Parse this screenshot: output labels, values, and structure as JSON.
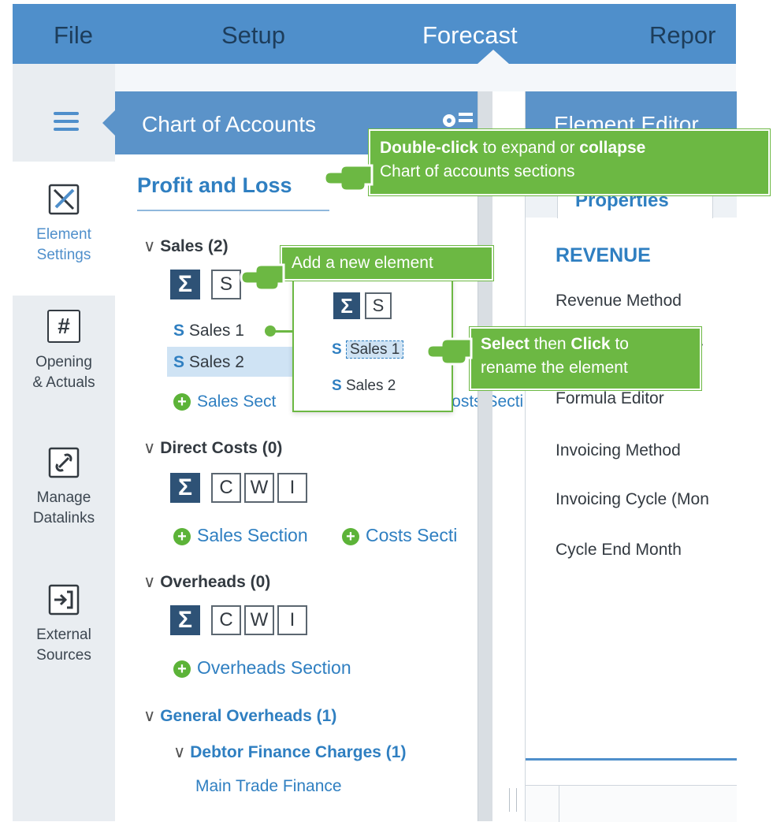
{
  "nav": {
    "file": "File",
    "setup": "Setup",
    "forecast": "Forecast",
    "reports": "Repor"
  },
  "sidebar": {
    "items": [
      {
        "label1": "Element",
        "label2": "Settings",
        "icon": "ruler-pencil-icon"
      },
      {
        "label1": "Opening",
        "label2": "& Actuals",
        "icon": "hash-icon"
      },
      {
        "label1": "Manage",
        "label2": "Datalinks",
        "icon": "link-icon"
      },
      {
        "label1": "External",
        "label2": "Sources",
        "icon": "import-icon"
      }
    ]
  },
  "coa": {
    "title": "Chart of Accounts",
    "section_title": "Profit and Loss",
    "sales": {
      "header": "Sales (2)",
      "items": [
        "Sales 1",
        "Sales 2"
      ],
      "add_sales": "Sales Sect",
      "add_costs": "Costs Secti"
    },
    "direct_costs": {
      "header": "Direct Costs (0)",
      "add_sales": "Sales Section",
      "add_costs": "Costs Secti"
    },
    "overheads": {
      "header": "Overheads (0)",
      "add_overheads": "Overheads Section"
    },
    "general_overheads": {
      "header": "General Overheads (1)",
      "sub_header": "Debtor Finance Charges (1)",
      "item": "Main Trade Finance"
    },
    "btn_s": "S",
    "btn_c": "C",
    "btn_w": "W",
    "btn_i": "I",
    "sigma": "Σ",
    "s_tag": "S"
  },
  "editor": {
    "title": "Element Editor",
    "tab": "Properties",
    "section": "REVENUE",
    "fields": [
      "Revenue Method",
      "Formula Editor",
      "Invoicing Method",
      "Invoicing Cycle (Mon",
      "Cycle End Month"
    ],
    "partial_r": "r"
  },
  "callouts": {
    "dbl_bold1": "Double-click",
    "dbl_text1": " to expand or ",
    "dbl_bold2": "collapse",
    "dbl_line2": "Chart of accounts sections",
    "add": "Add a new element",
    "sel_bold1": "Select",
    "sel_text1": " then ",
    "sel_bold2": "Click",
    "sel_text2": " to",
    "sel_line2": "rename the element"
  },
  "popup": {
    "item1": "Sales 1",
    "item2": "Sales 2"
  },
  "colors": {
    "nav": "#4f8fcb",
    "panel_header": "#5b93c9",
    "accent_green": "#6cb843",
    "link_blue": "#2f7fc1"
  }
}
